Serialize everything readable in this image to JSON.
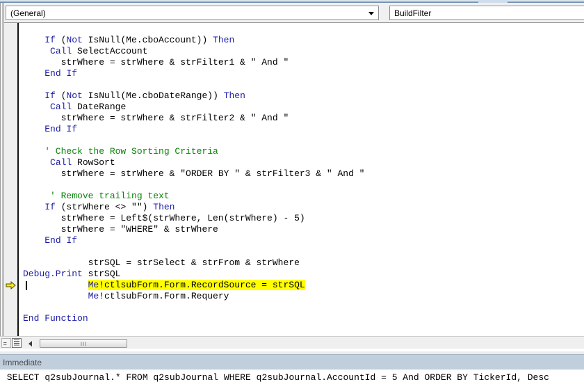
{
  "toolbar": {
    "object_dropdown": {
      "value": "(General)"
    },
    "procedure_dropdown": {
      "value": "BuildFilter"
    }
  },
  "code": {
    "lines": [
      {
        "seg": [
          [
            "n",
            "    "
          ],
          [
            "k",
            "If"
          ],
          [
            "n",
            " ("
          ],
          [
            "k",
            "Not"
          ],
          [
            "n",
            " IsNull(Me.cboAccount)) "
          ],
          [
            "k",
            "Then"
          ]
        ]
      },
      {
        "seg": [
          [
            "n",
            "     "
          ],
          [
            "k",
            "Call"
          ],
          [
            "n",
            " SelectAccount"
          ]
        ]
      },
      {
        "seg": [
          [
            "n",
            "       strWhere = strWhere & strFilter1 & \" And \""
          ]
        ]
      },
      {
        "seg": [
          [
            "n",
            "    "
          ],
          [
            "k",
            "End If"
          ]
        ]
      },
      {
        "seg": []
      },
      {
        "seg": [
          [
            "n",
            "    "
          ],
          [
            "k",
            "If"
          ],
          [
            "n",
            " ("
          ],
          [
            "k",
            "Not"
          ],
          [
            "n",
            " IsNull(Me.cboDateRange)) "
          ],
          [
            "k",
            "Then"
          ]
        ]
      },
      {
        "seg": [
          [
            "n",
            "     "
          ],
          [
            "k",
            "Call"
          ],
          [
            "n",
            " DateRange"
          ]
        ]
      },
      {
        "seg": [
          [
            "n",
            "       strWhere = strWhere & strFilter2 & \" And \""
          ]
        ]
      },
      {
        "seg": [
          [
            "n",
            "    "
          ],
          [
            "k",
            "End If"
          ]
        ]
      },
      {
        "seg": []
      },
      {
        "seg": [
          [
            "c",
            "    ' Check the Row Sorting Criteria"
          ]
        ]
      },
      {
        "seg": [
          [
            "n",
            "     "
          ],
          [
            "k",
            "Call"
          ],
          [
            "n",
            " RowSort"
          ]
        ]
      },
      {
        "seg": [
          [
            "n",
            "       strWhere = strWhere & \"ORDER BY \" & strFilter3 & \" And \""
          ]
        ]
      },
      {
        "seg": []
      },
      {
        "seg": [
          [
            "c",
            "     ' Remove trailing text"
          ]
        ]
      },
      {
        "seg": [
          [
            "n",
            "    "
          ],
          [
            "k",
            "If"
          ],
          [
            "n",
            " (strWhere <> \"\") "
          ],
          [
            "k",
            "Then"
          ]
        ]
      },
      {
        "seg": [
          [
            "n",
            "       strWhere = Left$(strWhere, Len(strWhere) - 5)"
          ]
        ]
      },
      {
        "seg": [
          [
            "n",
            "       strWhere = \"WHERE\" & strWhere"
          ]
        ]
      },
      {
        "seg": [
          [
            "n",
            "    "
          ],
          [
            "k",
            "End If"
          ]
        ]
      },
      {
        "seg": []
      },
      {
        "seg": [
          [
            "n",
            "            strSQL = strSelect & strFrom & strWhere"
          ]
        ]
      },
      {
        "seg": [
          [
            "k",
            "Debug.Print"
          ],
          [
            "n",
            " strSQL"
          ]
        ]
      },
      {
        "seg": [
          [
            "n",
            "            "
          ],
          [
            "k",
            "Me",
            "hl"
          ],
          [
            "n",
            "!ctlsubForm.Form.RecordSource = strSQL",
            "hl"
          ]
        ],
        "current": true
      },
      {
        "seg": [
          [
            "n",
            "            "
          ],
          [
            "k",
            "Me"
          ],
          [
            "n",
            "!ctlsubForm.Form.Requery"
          ]
        ]
      },
      {
        "seg": []
      },
      {
        "seg": [
          [
            "k",
            "End Function"
          ]
        ]
      }
    ]
  },
  "immediate": {
    "title": "Immediate",
    "line": " SELECT q2subJournal.* FROM q2subJournal WHERE q2subJournal.AccountId = 5 And ORDER BY TickerId, Desc"
  },
  "colors": {
    "keyword": "#1b1ba8",
    "comment": "#0a830a",
    "normal": "#000000",
    "highlight": "#ffff00",
    "immediate_bar": "#c1cfdc",
    "current_line_arrow": "#ffe81a"
  }
}
